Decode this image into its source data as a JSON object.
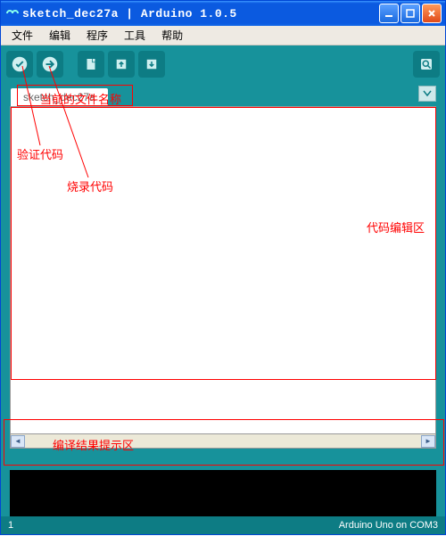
{
  "window": {
    "title": "sketch_dec27a | Arduino 1.0.5"
  },
  "menu": {
    "file": "文件",
    "edit": "编辑",
    "sketch": "程序",
    "tools": "工具",
    "help": "帮助"
  },
  "tab": {
    "name": "sketch_dec27a"
  },
  "statusbar": {
    "line": "1",
    "board": "Arduino Uno on COM3"
  },
  "annotations": {
    "filename_label": "当前的文件名称",
    "verify": "验证代码",
    "upload": "烧录代码",
    "editor_area": "代码编辑区",
    "console_area": "编译结果提示区"
  },
  "icons": {
    "verify": "check",
    "upload": "arrow-right",
    "new": "document",
    "open": "arrow-up",
    "save": "arrow-down",
    "serial": "magnifier"
  },
  "colors": {
    "titlebar": "#0b5ae0",
    "teal": "#17929b",
    "teal_dark": "#0d7c84",
    "annotation": "#ff0000"
  }
}
